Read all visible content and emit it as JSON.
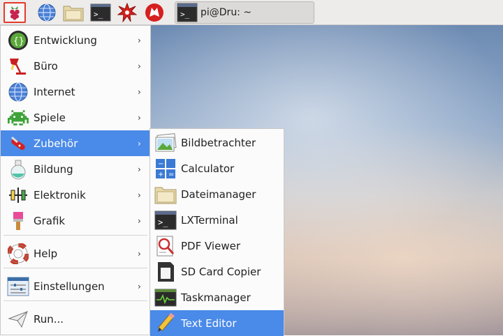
{
  "taskbar": {
    "launchers": [
      "raspberry-menu",
      "web-browser",
      "file-manager",
      "terminal",
      "math-app",
      "wolfram"
    ],
    "task_window_label": "pi@Dru: ~",
    "terminal_glyph": ">_"
  },
  "main_menu": {
    "items": [
      {
        "label": "Entwicklung",
        "icon": "code-braces-icon",
        "submenu": true
      },
      {
        "label": "Büro",
        "icon": "lamp-icon",
        "submenu": true
      },
      {
        "label": "Internet",
        "icon": "globe-icon",
        "submenu": true
      },
      {
        "label": "Spiele",
        "icon": "space-invader-icon",
        "submenu": true
      },
      {
        "label": "Zubehör",
        "icon": "swiss-knife-icon",
        "submenu": true,
        "selected": true
      },
      {
        "label": "Bildung",
        "icon": "flask-icon",
        "submenu": true
      },
      {
        "label": "Elektronik",
        "icon": "circuit-icon",
        "submenu": true
      },
      {
        "label": "Grafik",
        "icon": "paintbrush-icon",
        "submenu": true
      },
      {
        "label": "Help",
        "icon": "lifebuoy-icon",
        "submenu": true
      },
      {
        "label": "Einstellungen",
        "icon": "sliders-icon",
        "submenu": true
      },
      {
        "label": "Run...",
        "icon": "paper-plane-icon",
        "submenu": false
      }
    ]
  },
  "submenu": {
    "items": [
      {
        "label": "Bildbetrachter",
        "icon": "image-viewer-icon"
      },
      {
        "label": "Calculator",
        "icon": "calculator-icon"
      },
      {
        "label": "Dateimanager",
        "icon": "folder-icon"
      },
      {
        "label": "LXTerminal",
        "icon": "terminal-icon"
      },
      {
        "label": "PDF Viewer",
        "icon": "pdf-viewer-icon"
      },
      {
        "label": "SD Card Copier",
        "icon": "sd-card-icon"
      },
      {
        "label": "Taskmanager",
        "icon": "task-manager-icon"
      },
      {
        "label": "Text Editor",
        "icon": "text-editor-icon",
        "selected": true
      }
    ]
  },
  "arrow_glyph": "›",
  "colors": {
    "selection": "#4a8ae8",
    "active_border": "#e5392c"
  }
}
